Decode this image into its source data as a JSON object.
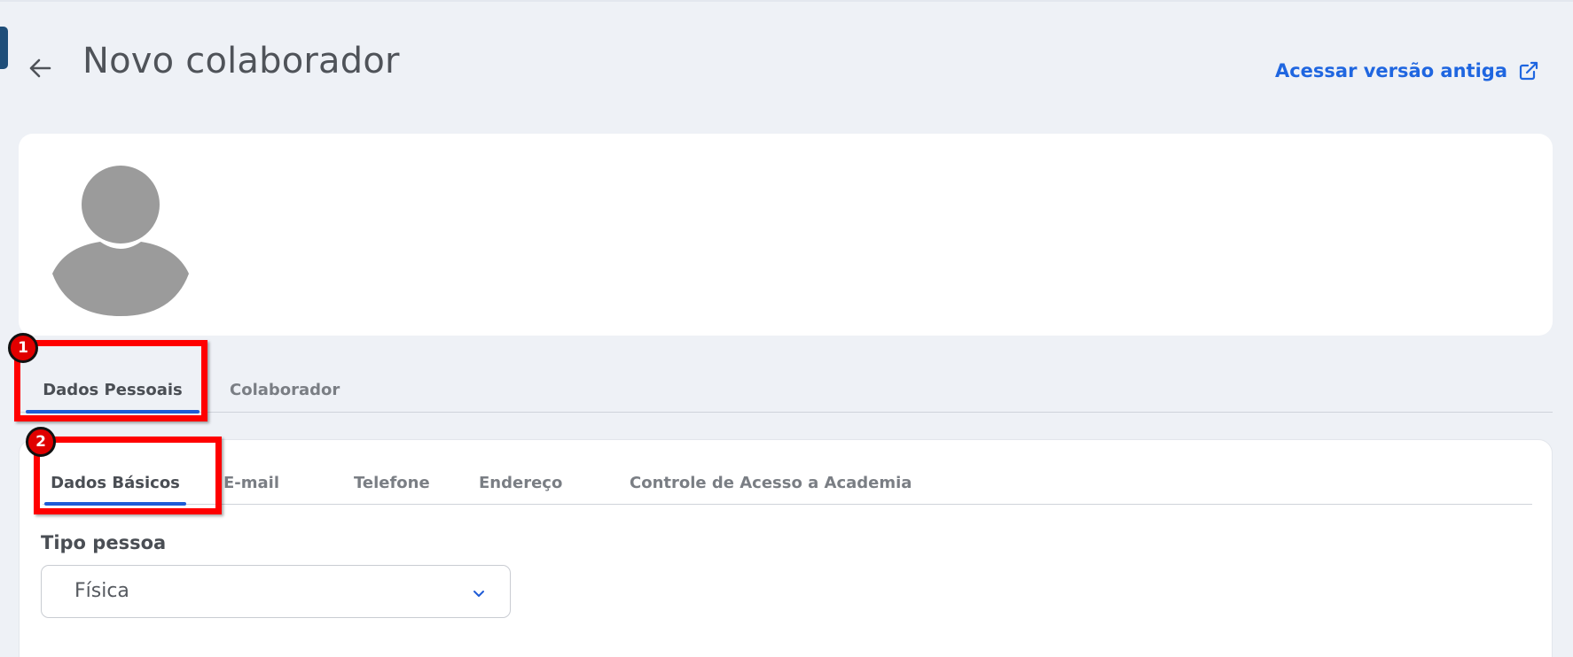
{
  "header": {
    "title": "Novo colaborador",
    "old_version_link": "Acessar versão antiga"
  },
  "main_tabs": [
    {
      "label": "Dados Pessoais",
      "active": true
    },
    {
      "label": "Colaborador",
      "active": false
    }
  ],
  "sub_tabs": [
    {
      "label": "Dados Básicos",
      "active": true
    },
    {
      "label": "E-mail",
      "active": false
    },
    {
      "label": "Telefone",
      "active": false
    },
    {
      "label": "Endereço",
      "active": false
    },
    {
      "label": "Controle de Acesso a Academia",
      "active": false
    }
  ],
  "form": {
    "tipo_pessoa_label": "Tipo pessoa",
    "tipo_pessoa_value": "Física"
  },
  "annotations": [
    {
      "number": "1"
    },
    {
      "number": "2"
    }
  ],
  "colors": {
    "accent": "#1f66e0",
    "tab_indicator": "#1f5bd6",
    "annotation": "#ff0000",
    "background": "#eef1f6"
  },
  "icons": {
    "back": "arrow-left-icon",
    "external": "external-link-icon",
    "avatar": "user-avatar-icon",
    "chevron": "chevron-down-icon"
  }
}
